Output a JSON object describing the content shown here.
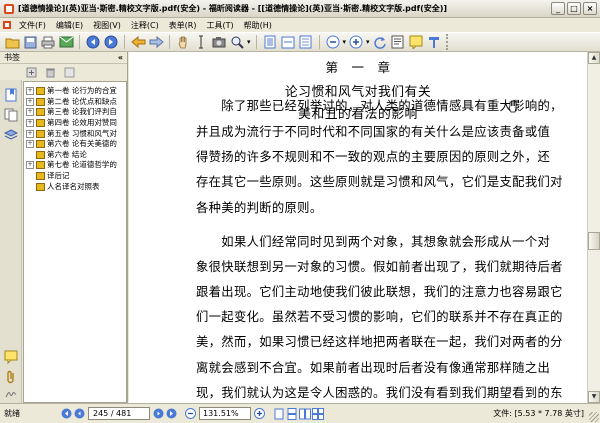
{
  "window": {
    "title": "[道德情操论](英)亚当·斯密.精校文字版.pdf(安全) - 福昕阅读器 - [[道德情操论](英)亚当·斯密.精校文字版.pdf(安全)]",
    "controls": [
      "minimize-icon",
      "maximize-icon",
      "close-icon"
    ]
  },
  "menu": [
    "文件(F)",
    "编辑(E)",
    "视图(V)",
    "注释(C)",
    "表单(R)",
    "工具(T)",
    "帮助(H)"
  ],
  "toolbar": {
    "icons": [
      "open-folder-icon",
      "save-icon",
      "print-icon",
      "email-icon",
      "first-page-icon",
      "last-page-icon",
      "prev-view-icon",
      "next-view-icon",
      "hand-tool-icon",
      "select-text-icon",
      "snapshot-icon",
      "zoom-icon",
      "fit-page-icon",
      "fit-width-icon",
      "actual-size-icon",
      "zoom-out-icon",
      "zoom-in-icon",
      "rotate-icon",
      "text-viewer-icon",
      "note-icon",
      "typewriter-icon"
    ]
  },
  "sidebar": {
    "panel_title": "书签",
    "collapse_glyph": "«",
    "rail_icons": [
      "bookmarks-panel-icon",
      "pages-panel-icon",
      "layers-panel-icon",
      "comments-panel-icon",
      "attachments-panel-icon",
      "signatures-panel-icon"
    ],
    "tree_items": [
      {
        "label": "第一卷  论行为的合宜",
        "expandable": true
      },
      {
        "label": "第二卷  论优点和缺点",
        "expandable": true
      },
      {
        "label": "第三卷  论我们评判自",
        "expandable": true
      },
      {
        "label": "第四卷  论效用对赞同",
        "expandable": true
      },
      {
        "label": "第五卷  习惯和风气对",
        "expandable": true
      },
      {
        "label": "第六卷  论有关美德的",
        "expandable": true
      },
      {
        "label": "第六卷  结论",
        "expandable": false
      },
      {
        "label": "第七卷  论道德哲学的",
        "expandable": true
      },
      {
        "label": "译后记",
        "expandable": false
      },
      {
        "label": "人名译名对照表",
        "expandable": false
      }
    ]
  },
  "document": {
    "chapter_heading": "第　一　章",
    "title_line_1": "论习惯和风气对我们有关",
    "title_line_2": "美和丑的看法的影响",
    "lines": [
      "　　除了那些已经列举过的，对人类的道德情感具有重大影响的，",
      "并且成为流行于不同时代和不同国家的有关什么是应该责备或值",
      "得赞扬的许多不规则和不一致的观点的主要原因的原则之外，还",
      "存在其它一些原则。这些原则就是习惯和风气，它们是支配我们对",
      "各种美的判断的原则。",
      "　　如果人们经常同时见到两个对象，其想象就会形成从一个对",
      "象很快联想到另一对象的习惯。假如前者出现了，我们就期待后者",
      "跟着出现。它们主动地使我们彼此联想，我们的注意力也容易跟它",
      "们一起变化。虽然若不受习惯的影响，它们的联系并不存在真正的",
      "美，然而，如果习惯已经这样地把两者联在一起，我们对两者的分",
      "离就会感到不合宜。如果前者出现时后者没有像通常那样随之出",
      "现，我们就认为这是令人困惑的。我们没有看到我们期望看到的东"
    ]
  },
  "statusbar": {
    "ready": "就绪",
    "page_field": "245 / 481",
    "zoom_field": "131.51%",
    "file_info": "文件: [5.53 * 7.78 英寸]"
  },
  "colors": {
    "chrome": "#ece9d8",
    "accent_blue": "#2a62c9",
    "bookmark_yellow": "#e6b81e"
  }
}
